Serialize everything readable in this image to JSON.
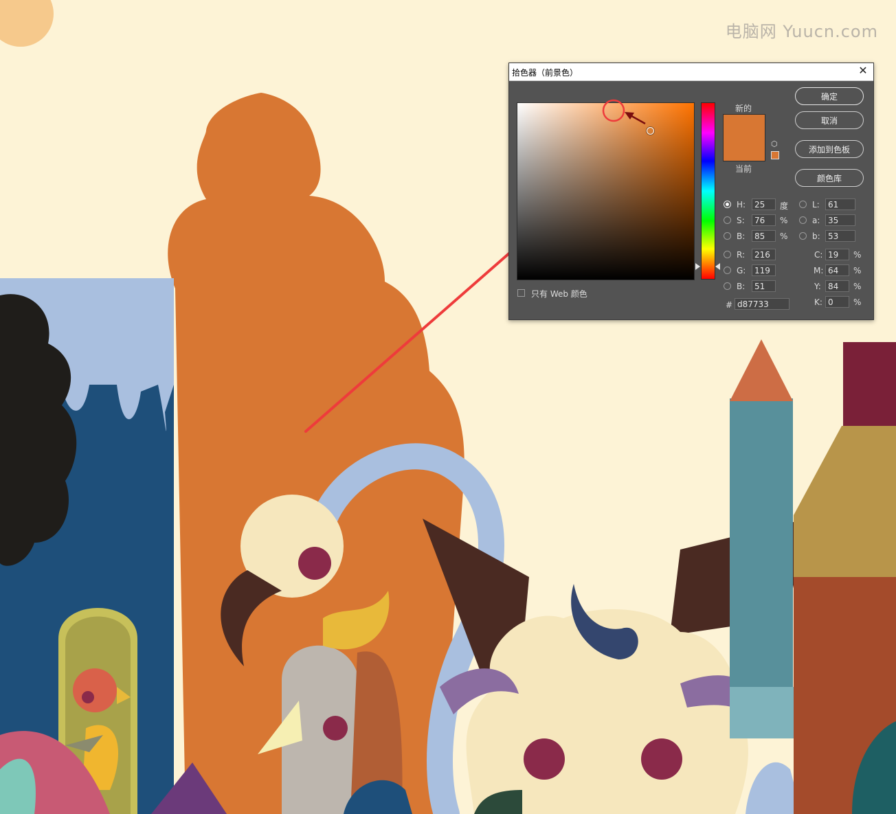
{
  "watermark": "电脑网 Yuucn.com",
  "dialog": {
    "title": "拾色器（前景色）",
    "close_label": "✕",
    "buttons": {
      "ok": "确定",
      "cancel": "取消",
      "add_to_swatches": "添加到色板",
      "color_libraries": "颜色库"
    },
    "new_label": "新的",
    "current_label": "当前",
    "web_only_label": "只有 Web 颜色",
    "fields": {
      "H": {
        "label": "H:",
        "value": "25",
        "unit": "度"
      },
      "S": {
        "label": "S:",
        "value": "76",
        "unit": "%"
      },
      "Bv": {
        "label": "B:",
        "value": "85",
        "unit": "%"
      },
      "R": {
        "label": "R:",
        "value": "216"
      },
      "G": {
        "label": "G:",
        "value": "119"
      },
      "B": {
        "label": "B:",
        "value": "51"
      },
      "L": {
        "label": "L:",
        "value": "61"
      },
      "a": {
        "label": "a:",
        "value": "35"
      },
      "lab_b": {
        "label": "b:",
        "value": "53"
      },
      "C": {
        "label": "C:",
        "value": "19",
        "unit": "%"
      },
      "M": {
        "label": "M:",
        "value": "64",
        "unit": "%"
      },
      "Y": {
        "label": "Y:",
        "value": "84",
        "unit": "%"
      },
      "K": {
        "label": "K:",
        "value": "0",
        "unit": "%"
      },
      "hex_label": "#",
      "hex": "d87733"
    },
    "selected_color": "#d87733",
    "selected_mode": "H"
  },
  "colors": {
    "orange": "#d87733",
    "annotation_red": "#ee3b3b",
    "cream_bg": "#fdf3d6"
  }
}
